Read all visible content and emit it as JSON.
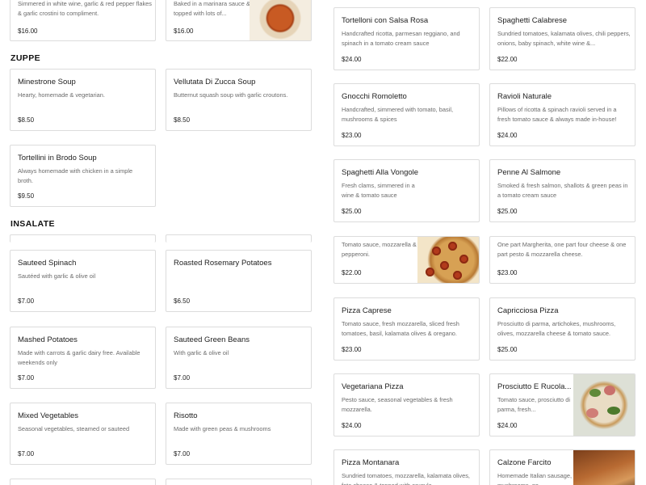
{
  "sections": {
    "zuppe": "ZUPPE",
    "insalate": "INSALATE"
  },
  "left": {
    "top_a": {
      "desc": "Simmered in white wine, garlic & red pepper flakes & garlic crostini to compliment.",
      "price": "$16.00"
    },
    "top_b": {
      "desc": "Baked in a marinara sauce & topped with lots of...",
      "price": "$16.00"
    },
    "minestrone": {
      "name": "Minestrone Soup",
      "desc": "Hearty, homemade & vegetarian.",
      "price": "$8.50"
    },
    "vellutata": {
      "name": "Vellutata Di Zucca Soup",
      "desc": "Butternut squash soup with garlic croutons.",
      "price": "$8.50"
    },
    "tortellini": {
      "name": "Tortellini in Brodo Soup",
      "desc": "Always homemade with chicken in a simple broth.",
      "price": "$9.50"
    },
    "spinach": {
      "name": "Sauteed Spinach",
      "desc": "Sautéed with garlic & olive oil",
      "price": "$7.00"
    },
    "rosemary": {
      "name": "Roasted Rosemary Potatoes",
      "desc": "",
      "price": "$6.50"
    },
    "mashed": {
      "name": "Mashed Potatoes",
      "desc": "Made with carrots & garlic dairy free. Available weekends only",
      "price": "$7.00"
    },
    "greenbeans": {
      "name": "Sauteed Green Beans",
      "desc": "With garlic & olive oil",
      "price": "$7.00"
    },
    "mixedveg": {
      "name": "Mixed Vegetables",
      "desc": "Seasonal vegetables, steamed or sauteed",
      "price": "$7.00"
    },
    "risotto": {
      "name": "Risotto",
      "desc": "Made with green peas & mushrooms",
      "price": "$7.00"
    }
  },
  "right": {
    "tortelloni": {
      "name": "Tortelloni con Salsa Rosa",
      "desc": "Handcrafted ricotta, parmesan reggiano, and spinach in a tomato cream sauce",
      "price": "$24.00"
    },
    "calabrese": {
      "name": "Spaghetti Calabrese",
      "desc": "Sundried tomatoes, kalamata olives, chili peppers, onions, baby spinach, white wine &...",
      "price": "$22.00"
    },
    "gnocchi": {
      "name": "Gnocchi Romoletto",
      "desc": "Handcrafted, simmered with tomato, basil, mushrooms & spices",
      "price": "$23.00"
    },
    "ravioli": {
      "name": "Ravioli Naturale",
      "desc": "Pillows of ricotta & spinach ravioli served in a fresh tomato sauce & always made in-house!",
      "price": "$24.00"
    },
    "vongole": {
      "name": "Spaghetti Alla Vongole",
      "desc": "Fresh clams, simmered in a wine & tomato sauce",
      "price": "$25.00"
    },
    "salmone": {
      "name": "Penne Al Salmone",
      "desc": "Smoked & fresh salmon, shallots & green peas in a tomato cream sauce",
      "price": "$25.00"
    },
    "pep_pizza": {
      "desc": "Tomato sauce, mozzarella & pepperoni.",
      "price": "$22.00"
    },
    "half_pizza": {
      "desc": "One part Margherita, one part four cheese & one part pesto & mozzarella cheese.",
      "price": "$23.00"
    },
    "caprese": {
      "name": "Pizza Caprese",
      "desc": "Tomato sauce, fresh mozzarella, sliced fresh tomatoes, basil, kalamata olives & oregano.",
      "price": "$23.00"
    },
    "capricciosa": {
      "name": "Capricciosa Pizza",
      "desc": "Prosciutto di parma, artichokes, mushrooms, olives, mozzarella cheese & tomato sauce.",
      "price": "$25.00"
    },
    "vegetariana": {
      "name": "Vegetariana Pizza",
      "desc": "Pesto sauce, seasonal vegetables & fresh mozzarella.",
      "price": "$24.00"
    },
    "rucola": {
      "name": "Prosciutto E Rucola...",
      "desc": "Tomato sauce, prosciutto di parma, fresh...",
      "price": "$24.00"
    },
    "montanara": {
      "name": "Pizza Montanara",
      "desc": "Sundried tomatoes, mozzarella, kalamata olives, feta cheese & topped with arugula."
    },
    "calzone": {
      "name": "Calzone Farcito",
      "desc": "Homemade Italian sausage, mushrooms, go..."
    }
  }
}
